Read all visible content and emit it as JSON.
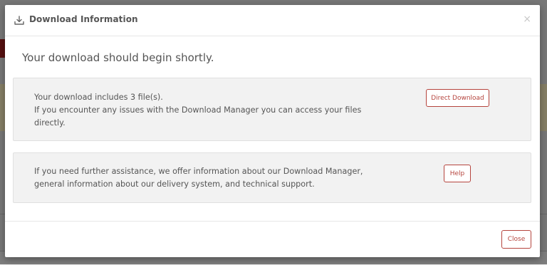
{
  "modal": {
    "title": "Download Information",
    "close_glyph": "×",
    "lead": "Your download should begin shortly.",
    "panels": [
      {
        "lines": [
          "Your download includes 3 file(s).",
          "If you encounter any issues with the Download Manager you can access your files directly."
        ],
        "button_label": "Direct Download"
      },
      {
        "lines": [
          "If you need further assistance, we offer information about our Download Manager, general information about our delivery system, and technical support."
        ],
        "button_label": "Help"
      }
    ],
    "footer_button_label": "Close"
  },
  "icons": {
    "header": "download-icon",
    "close": "close-icon"
  },
  "colors": {
    "accent": "#b5443d",
    "panel_bg": "#f2f2f2",
    "text": "#555555"
  }
}
